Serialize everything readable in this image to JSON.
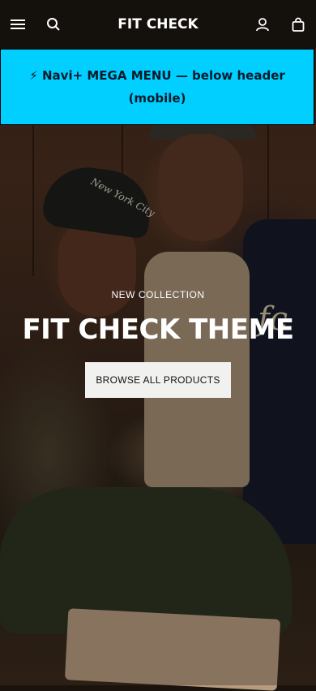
{
  "header": {
    "brand": "FIT CHECK",
    "icons": [
      "menu-icon",
      "search-icon",
      "account-icon",
      "bag-icon"
    ]
  },
  "mega_menu": {
    "text": "⚡ Navi+ MEGA MENU — below header (mobile)",
    "background": "#00cfff"
  },
  "hero": {
    "eyebrow": "NEW COLLECTION",
    "title": "FIT CHECK THEME",
    "cta_label": "BROWSE ALL PRODUCTS",
    "cap_text": "New York City",
    "jacket_letters": "fc"
  },
  "colors": {
    "header_bg": "#14100c",
    "text_light": "#ffffff",
    "cta_bg": "#f1f1ef"
  }
}
